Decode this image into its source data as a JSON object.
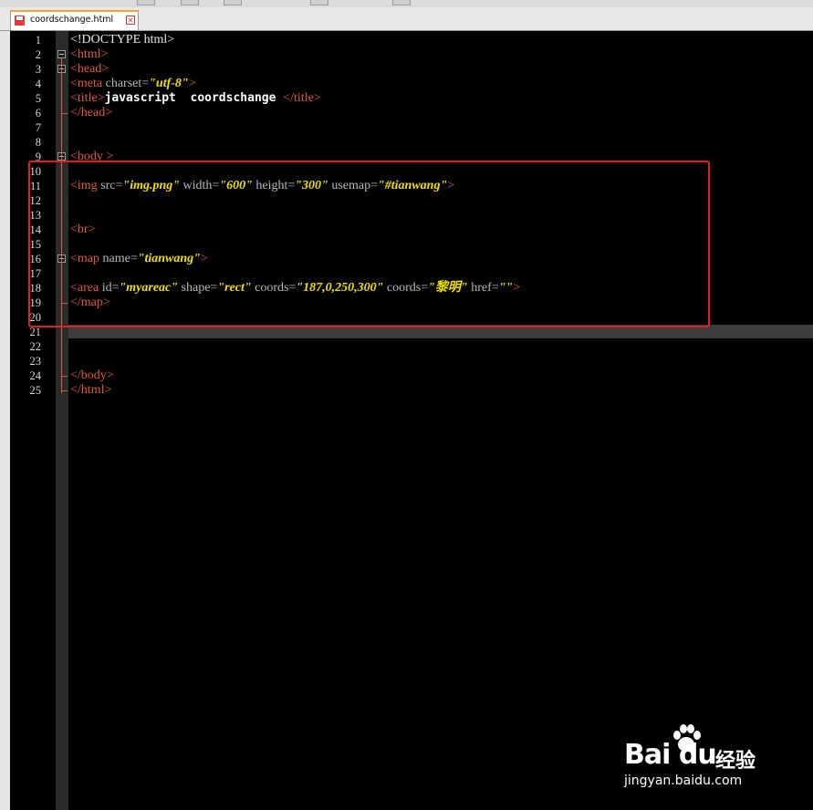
{
  "tab": {
    "filename": "coordschange.html",
    "close_glyph": "×"
  },
  "line_numbers": [
    "1",
    "2",
    "3",
    "4",
    "5",
    "6",
    "7",
    "8",
    "9",
    "10",
    "11",
    "12",
    "13",
    "14",
    "15",
    "16",
    "17",
    "18",
    "19",
    "20",
    "21",
    "22",
    "23",
    "24",
    "25"
  ],
  "code_lines": [
    [
      {
        "c": "plain",
        "t": "<!DOCTYPE html>"
      }
    ],
    [
      {
        "c": "tag",
        "t": "<html>"
      }
    ],
    [
      {
        "c": "tag",
        "t": "<head>"
      }
    ],
    [
      {
        "c": "tag",
        "t": "<meta "
      },
      {
        "c": "attr",
        "t": "charset="
      },
      {
        "c": "str",
        "t": "\"utf-8\""
      },
      {
        "c": "tag",
        "t": ">"
      }
    ],
    [
      {
        "c": "tag",
        "t": "<title>"
      },
      {
        "c": "txt",
        "t": "javascript  coordschange "
      },
      {
        "c": "tag",
        "t": "</title>"
      }
    ],
    [
      {
        "c": "tag",
        "t": "</head>"
      }
    ],
    [],
    [],
    [
      {
        "c": "tag",
        "t": "<body >"
      }
    ],
    [],
    [
      {
        "c": "tag",
        "t": "<img "
      },
      {
        "c": "attr",
        "t": "src="
      },
      {
        "c": "str",
        "t": "\"img.png\""
      },
      {
        "c": "attr",
        "t": " width="
      },
      {
        "c": "str",
        "t": "\"600\""
      },
      {
        "c": "attr",
        "t": " height="
      },
      {
        "c": "str",
        "t": "\"300\""
      },
      {
        "c": "attr",
        "t": " usemap="
      },
      {
        "c": "str",
        "t": "\"#tianwang\""
      },
      {
        "c": "tag",
        "t": ">"
      }
    ],
    [],
    [],
    [
      {
        "c": "tag",
        "t": "<br>"
      }
    ],
    [],
    [
      {
        "c": "tag",
        "t": "<map "
      },
      {
        "c": "attr",
        "t": "name="
      },
      {
        "c": "str",
        "t": "\"tianwang\""
      },
      {
        "c": "tag",
        "t": ">"
      }
    ],
    [],
    [
      {
        "c": "tag",
        "t": "<area "
      },
      {
        "c": "attr",
        "t": "id="
      },
      {
        "c": "str",
        "t": "\"myareac\""
      },
      {
        "c": "attr",
        "t": " shape="
      },
      {
        "c": "str",
        "t": "\"rect\""
      },
      {
        "c": "attr",
        "t": " coords="
      },
      {
        "c": "str",
        "t": "\"187,0,250,300\""
      },
      {
        "c": "attr",
        "t": " coords="
      },
      {
        "c": "str",
        "t": "\"黎明\""
      },
      {
        "c": "attr",
        "t": " href="
      },
      {
        "c": "str",
        "t": "\"\""
      },
      {
        "c": "tag",
        "t": ">"
      }
    ],
    [
      {
        "c": "tag",
        "t": "</map>"
      }
    ],
    [],
    [],
    [],
    [],
    [
      {
        "c": "tag",
        "t": "</body>"
      }
    ],
    [
      {
        "c": "tag",
        "t": "</html>"
      }
    ]
  ],
  "watermark": {
    "logo": "Bai du",
    "brand_cn": "经验",
    "url": "jingyan.baidu.com"
  },
  "colors": {
    "tag": "#e25a3c",
    "attribute": "#b8b8b8",
    "string": "#f0e000",
    "text": "#ffffff",
    "highlight": "#e02020"
  }
}
